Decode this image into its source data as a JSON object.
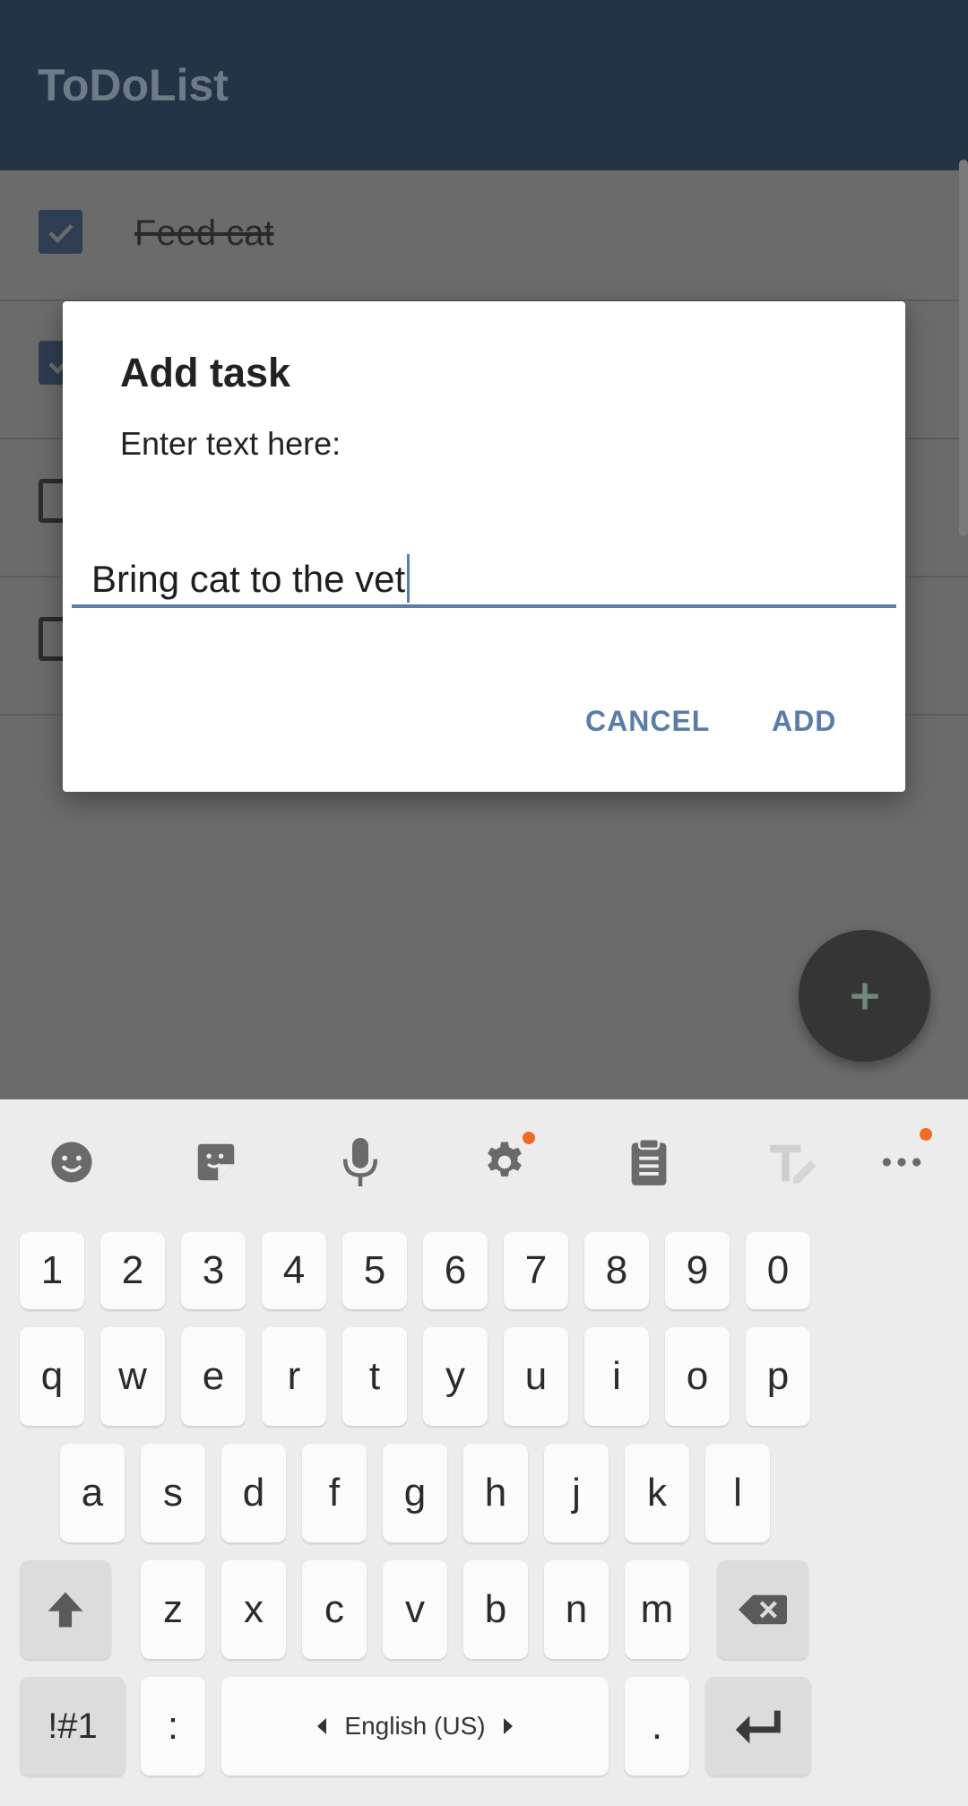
{
  "app": {
    "title": "ToDoList",
    "tasks": [
      {
        "label": "Feed cat",
        "checked": true
      },
      {
        "label": "",
        "checked": true
      },
      {
        "label": "",
        "checked": false
      },
      {
        "label": "",
        "checked": false
      }
    ]
  },
  "dialog": {
    "title": "Add task",
    "message": "Enter text here:",
    "input_value": "Bring cat to the vet",
    "cancel_label": "CANCEL",
    "add_label": "ADD"
  },
  "keyboard": {
    "toolbar_icons": [
      "emoji-icon",
      "sticker-icon",
      "microphone-icon",
      "settings-icon",
      "clipboard-icon",
      "text-edit-icon",
      "more-icon"
    ],
    "number_row": [
      "1",
      "2",
      "3",
      "4",
      "5",
      "6",
      "7",
      "8",
      "9",
      "0"
    ],
    "row1": [
      "q",
      "w",
      "e",
      "r",
      "t",
      "y",
      "u",
      "i",
      "o",
      "p"
    ],
    "row2": [
      "a",
      "s",
      "d",
      "f",
      "g",
      "h",
      "j",
      "k",
      "l"
    ],
    "row3": [
      "z",
      "x",
      "c",
      "v",
      "b",
      "n",
      "m"
    ],
    "symbols_label": "!#1",
    "colon_label": ":",
    "space_label": "English (US)",
    "period_label": ".",
    "accent_color": "#f06c25"
  },
  "colors": {
    "appbar": "#253347",
    "accent": "#5a7da8",
    "checkbox_checked": "#2e3d52"
  }
}
